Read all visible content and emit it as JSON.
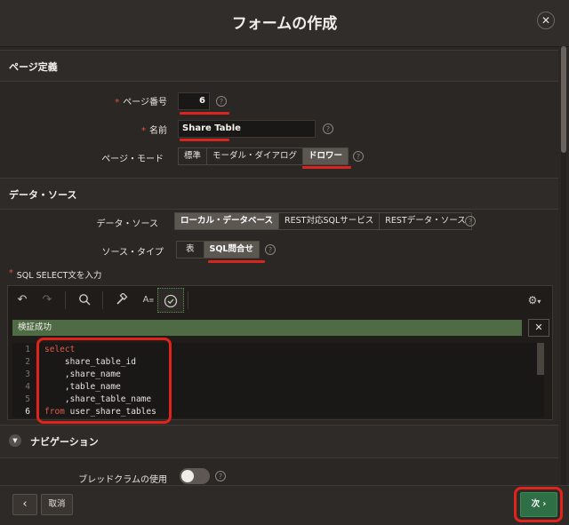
{
  "dialog": {
    "title": "フォームの作成",
    "close": "✕"
  },
  "page_def": {
    "section_title": "ページ定義",
    "page_number_label": "ページ番号",
    "page_number_value": "6",
    "name_label": "名前",
    "name_value": "Share Table",
    "page_mode_label": "ページ・モード",
    "page_mode_options": [
      "標準",
      "モーダル・ダイアログ",
      "ドロワー"
    ],
    "page_mode_selected": "ドロワー"
  },
  "data_source": {
    "section_title": "データ・ソース",
    "source_label": "データ・ソース",
    "source_options": [
      "ローカル・データベース",
      "REST対応SQLサービス",
      "RESTデータ・ソース"
    ],
    "source_selected": "ローカル・データベース",
    "source_type_label": "ソース・タイプ",
    "source_type_options": [
      "表",
      "SQL問合せ"
    ],
    "source_type_selected": "SQL問合せ",
    "sql_label": "SQL SELECT文を入力"
  },
  "editor": {
    "validation_message": "検証成功",
    "lines": [
      {
        "num": "1",
        "kw": "select",
        "text": ""
      },
      {
        "num": "2",
        "kw": "",
        "text": "    share_table_id"
      },
      {
        "num": "3",
        "kw": "",
        "text": "    ,share_name"
      },
      {
        "num": "4",
        "kw": "",
        "text": "    ,table_name"
      },
      {
        "num": "5",
        "kw": "",
        "text": "    ,share_table_name"
      },
      {
        "num": "6",
        "kw": "from",
        "text": " user_share_tables"
      }
    ]
  },
  "navigation": {
    "section_title": "ナビゲーション",
    "breadcrumb_label": "ブレッドクラムの使用",
    "breadcrumb_enabled": false
  },
  "footer": {
    "back": "‹",
    "cancel": "取消",
    "next": "次 ›"
  },
  "help_glyph": "?",
  "required_glyph": "*",
  "colors": {
    "accent_red": "#d9251d",
    "success_green": "#4e6b45",
    "next_button": "#2e6f45"
  }
}
